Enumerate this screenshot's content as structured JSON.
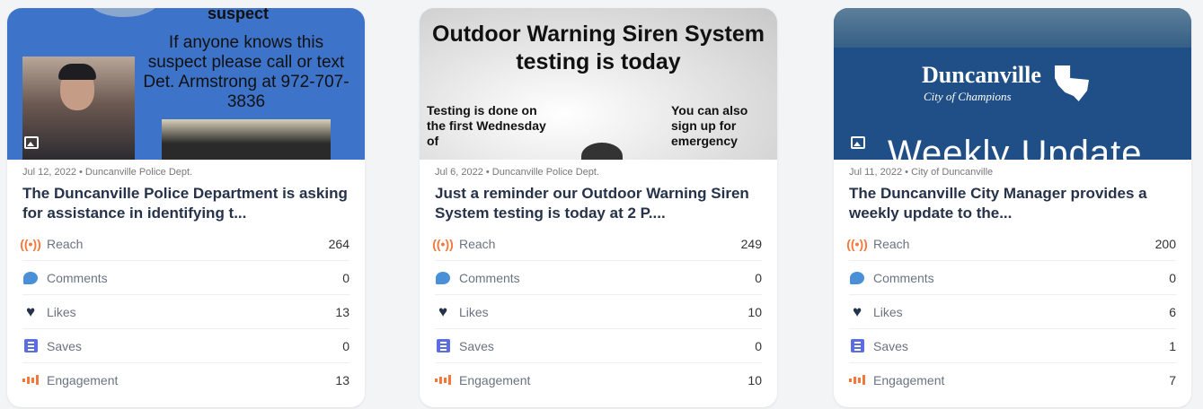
{
  "cards": [
    {
      "thumb": {
        "heading": "suspect",
        "body": "If anyone knows this suspect  please call or text Det. Armstrong at 972-707-3836"
      },
      "meta": "Jul 12, 2022 • Duncanville Police Dept.",
      "title": "The Duncanville Police Department is asking for assistance in identifying t...",
      "metrics": [
        {
          "icon": "reach-icon",
          "label": "Reach",
          "value": "264"
        },
        {
          "icon": "comment-icon",
          "label": "Comments",
          "value": "0"
        },
        {
          "icon": "heart-icon",
          "label": "Likes",
          "value": "13"
        },
        {
          "icon": "save-icon",
          "label": "Saves",
          "value": "0"
        },
        {
          "icon": "engagement-icon",
          "label": "Engagement",
          "value": "13"
        }
      ]
    },
    {
      "thumb": {
        "title": "Outdoor Warning Siren System testing is today",
        "left": "Testing is done on the first Wednesday of",
        "right": "You can also sign up for emergency"
      },
      "meta": "Jul 6, 2022 • Duncanville Police Dept.",
      "title": "Just a reminder our Outdoor Warning Siren System testing is today at 2 P....",
      "metrics": [
        {
          "icon": "reach-icon",
          "label": "Reach",
          "value": "249"
        },
        {
          "icon": "comment-icon",
          "label": "Comments",
          "value": "0"
        },
        {
          "icon": "heart-icon",
          "label": "Likes",
          "value": "10"
        },
        {
          "icon": "save-icon",
          "label": "Saves",
          "value": "0"
        },
        {
          "icon": "engagement-icon",
          "label": "Engagement",
          "value": "10"
        }
      ]
    },
    {
      "thumb": {
        "brand": "Duncanville",
        "tagline": "City of Champions",
        "overlay": "Weekly Update"
      },
      "meta": "Jul 11, 2022 • City of Duncanville",
      "title": "The Duncanville City Manager provides a weekly update to the...",
      "metrics": [
        {
          "icon": "reach-icon",
          "label": "Reach",
          "value": "200"
        },
        {
          "icon": "comment-icon",
          "label": "Comments",
          "value": "0"
        },
        {
          "icon": "heart-icon",
          "label": "Likes",
          "value": "6"
        },
        {
          "icon": "save-icon",
          "label": "Saves",
          "value": "1"
        },
        {
          "icon": "engagement-icon",
          "label": "Engagement",
          "value": "7"
        }
      ]
    }
  ],
  "colors": {
    "reach": "#f4773b",
    "comments": "#4a90d9",
    "likes": "#233249",
    "saves": "#5b6ee1",
    "engagement": "#f4773b",
    "title": "#26324a"
  }
}
